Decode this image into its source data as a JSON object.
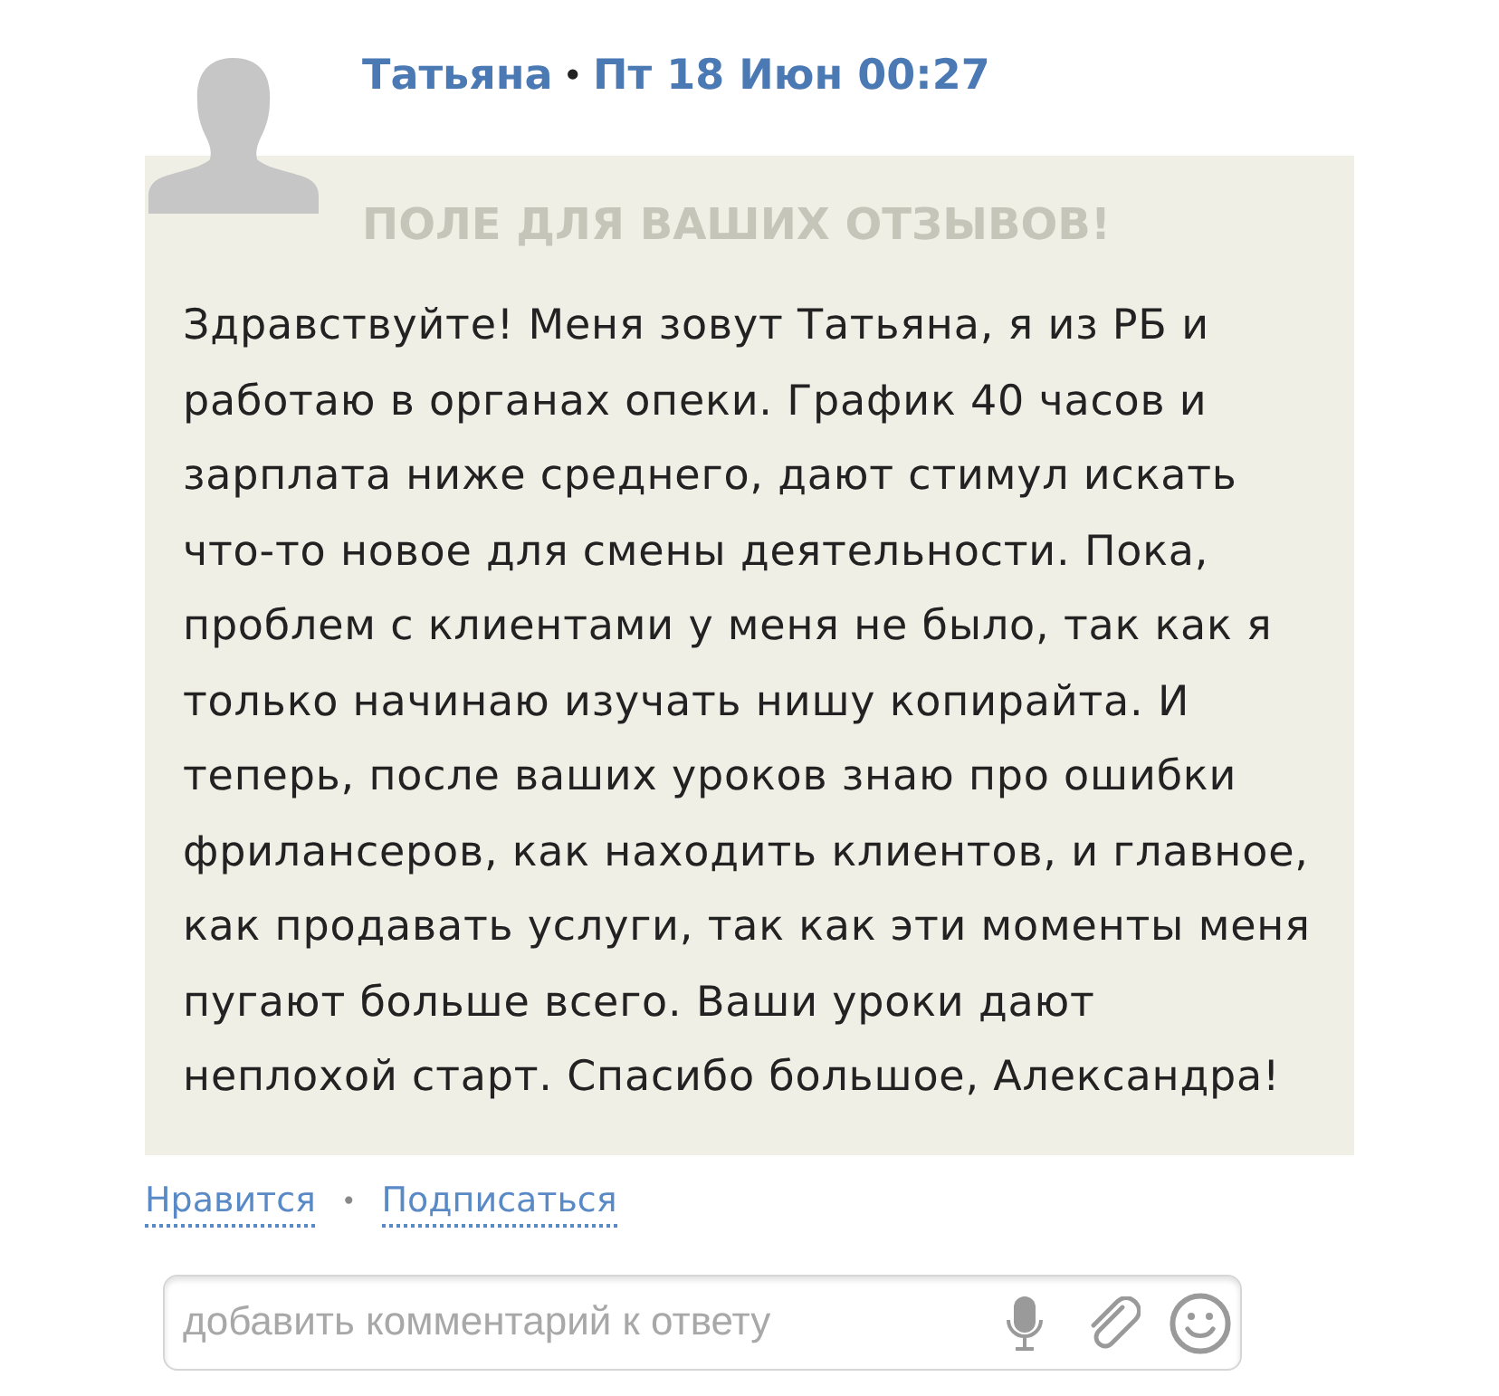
{
  "post": {
    "author": "Татьяна",
    "separator": "•",
    "date": "Пт 18 Июн 00:27",
    "banner": "ПОЛЕ ДЛЯ ВАШИХ ОТЗЫВОВ!",
    "text_lines": [
      "Здравствуйте! Меня зовут Татьяна, я из РБ и",
      "работаю в органах опеки. График 40 часов и",
      "зарплата ниже среднего, дают стимул искать",
      "что-то новое для смены деятельности. Пока,",
      "проблем с клиентами у меня не было, так как я",
      "только начинаю изучать нишу копирайта. И",
      "теперь, после ваших уроков знаю про ошибки",
      "фрилансеров, как находить клиентов, и главное,",
      "как продавать услуги, так как эти моменты меня",
      "пугают больше всего. Ваши уроки дают",
      "неплохой старт. Спасибо большое, Александра!"
    ]
  },
  "actions": [
    {
      "label": "Нравится"
    },
    {
      "label": "Подписаться"
    }
  ],
  "action_separator": "•",
  "comment_field": {
    "placeholder": "добавить комментарий к ответу"
  }
}
